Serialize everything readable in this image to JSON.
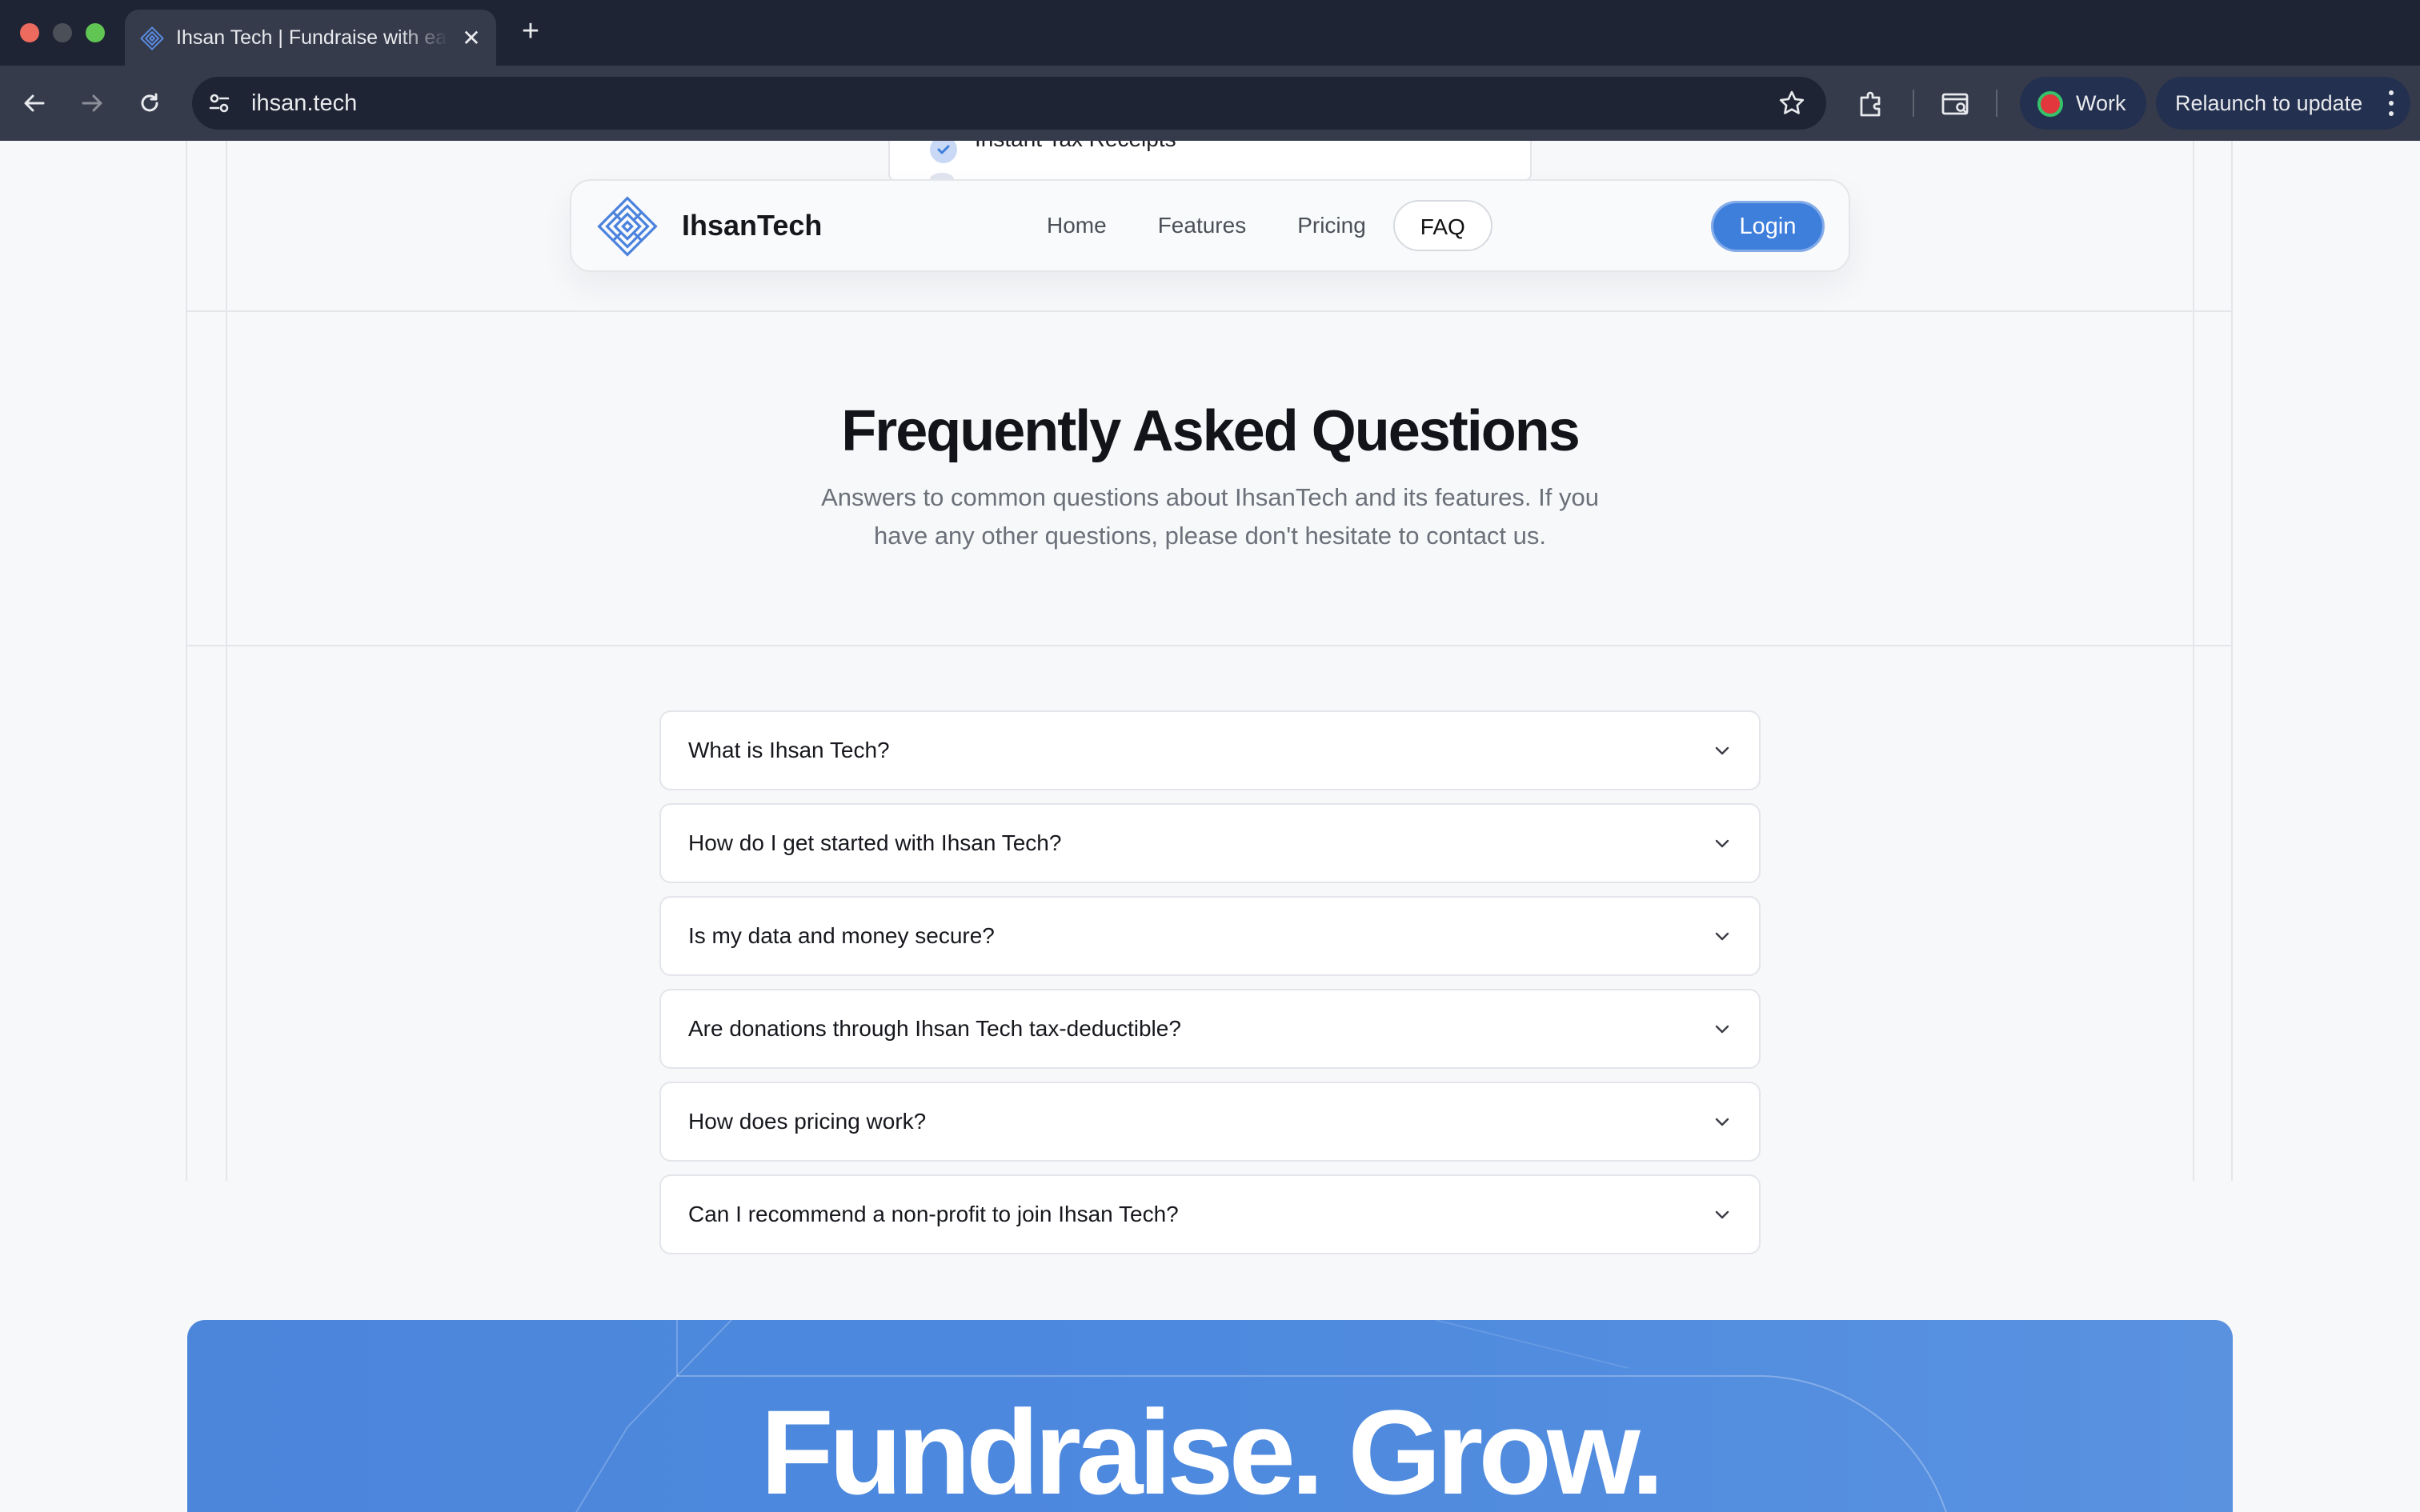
{
  "browser": {
    "tab": {
      "title": "Ihsan Tech | Fundraise with ease"
    },
    "omnibox": {
      "url": "ihsan.tech"
    },
    "profile": {
      "label": "Work"
    },
    "relaunch": {
      "label": "Relaunch to update"
    },
    "colors": {
      "chrome_dark": "#1e2433",
      "chrome_toolbar": "#353b4b"
    }
  },
  "page": {
    "peek_card": {
      "item": "Instant Tax Receipts"
    },
    "navbar": {
      "brand": "IhsanTech",
      "links": [
        "Home",
        "Features",
        "Pricing",
        "FAQ"
      ],
      "active_link": "FAQ",
      "login_label": "Login"
    },
    "faq": {
      "title": "Frequently Asked Questions",
      "subtitle": "Answers to common questions about IhsanTech and its features. If you have any other questions, please don't hesitate to contact us.",
      "items": [
        "What is Ihsan Tech?",
        "How do I get started with Ihsan Tech?",
        "Is my data and money secure?",
        "Are donations through Ihsan Tech tax-deductible?",
        "How does pricing work?",
        "Can I recommend a non-profit to join Ihsan Tech?"
      ]
    },
    "cta": {
      "title": "Fundraise. Grow."
    },
    "colors": {
      "accent": "#3f7fdc",
      "background": "#f7f8fa",
      "text": "#121419"
    }
  }
}
